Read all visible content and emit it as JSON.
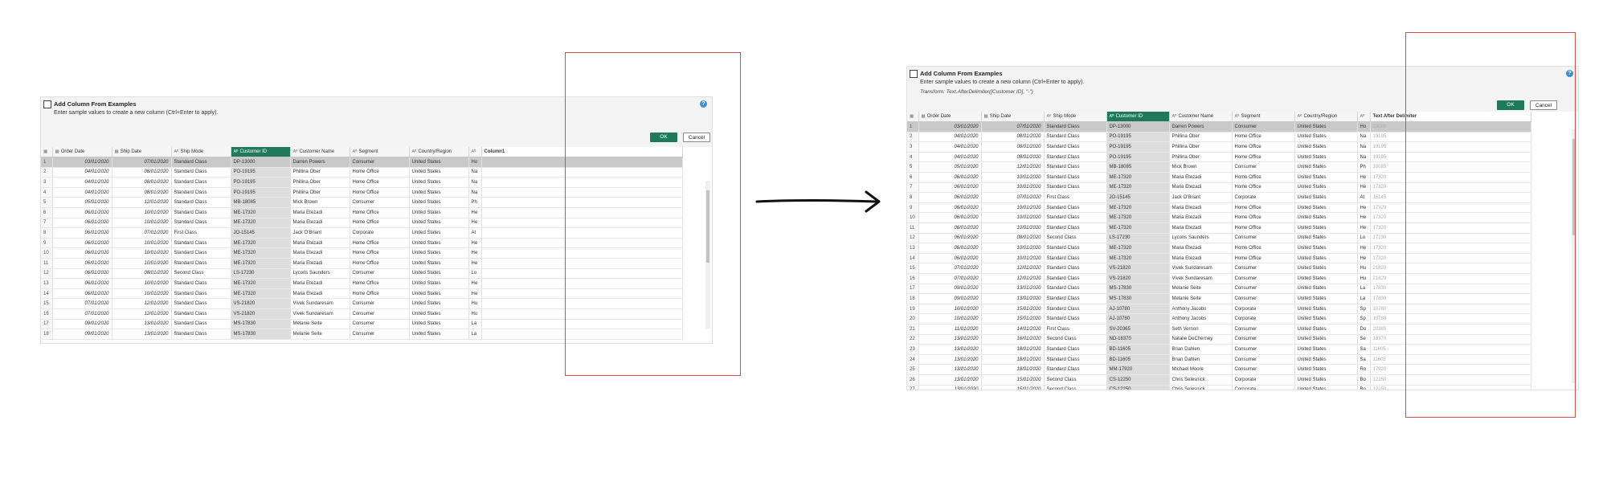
{
  "dialog": {
    "title": "Add Column From Examples",
    "subtitle": "Enter sample values to create a new column (Ctrl+Enter to apply).",
    "ok": "OK",
    "cancel": "Cancel",
    "help": "?",
    "transform": "Transform: Text.AfterDelimiter([Customer ID], \"-\")"
  },
  "icons": {
    "help": "question-circle-icon",
    "arrow": "right-arrow-icon",
    "table": "table-icon",
    "calendar": "calendar-icon",
    "text": "abc-text-icon",
    "checkbox": "checkbox-icon"
  },
  "colors": {
    "accent": "#1f7a5c",
    "highlight": "#e04848"
  },
  "before": {
    "columns": [
      "Order Date",
      "Ship Date",
      "Ship Mode",
      "Customer ID",
      "Customer Name",
      "Segment",
      "Country/Region",
      "",
      "Column1"
    ],
    "rows": [
      [
        "1",
        "03/01/2020",
        "07/01/2020",
        "Standard Class",
        "DP-13000",
        "Darren Powers",
        "Consumer",
        "United States",
        "Ho",
        ""
      ],
      [
        "2",
        "04/01/2020",
        "08/01/2020",
        "Standard Class",
        "PO-19195",
        "Phillina Ober",
        "Home Office",
        "United States",
        "Na",
        ""
      ],
      [
        "3",
        "04/01/2020",
        "08/01/2020",
        "Standard Class",
        "PO-19195",
        "Phillina Ober",
        "Home Office",
        "United States",
        "Na",
        ""
      ],
      [
        "4",
        "04/01/2020",
        "08/01/2020",
        "Standard Class",
        "PO-19195",
        "Phillina Ober",
        "Home Office",
        "United States",
        "Na",
        ""
      ],
      [
        "5",
        "05/01/2020",
        "12/01/2020",
        "Standard Class",
        "MB-18085",
        "Mick Brown",
        "Consumer",
        "United States",
        "Ph",
        ""
      ],
      [
        "6",
        "06/01/2020",
        "10/01/2020",
        "Standard Class",
        "ME-17320",
        "Maria Etezadi",
        "Home Office",
        "United States",
        "He",
        ""
      ],
      [
        "7",
        "06/01/2020",
        "10/01/2020",
        "Standard Class",
        "ME-17320",
        "Maria Etezadi",
        "Home Office",
        "United States",
        "He",
        ""
      ],
      [
        "8",
        "06/01/2020",
        "07/01/2020",
        "First Class",
        "JO-15145",
        "Jack O'Briant",
        "Corporate",
        "United States",
        "At",
        ""
      ],
      [
        "9",
        "06/01/2020",
        "10/01/2020",
        "Standard Class",
        "ME-17320",
        "Maria Etezadi",
        "Home Office",
        "United States",
        "He",
        ""
      ],
      [
        "10",
        "06/01/2020",
        "10/01/2020",
        "Standard Class",
        "ME-17320",
        "Maria Etezadi",
        "Home Office",
        "United States",
        "He",
        ""
      ],
      [
        "11",
        "06/01/2020",
        "10/01/2020",
        "Standard Class",
        "ME-17320",
        "Maria Etezadi",
        "Home Office",
        "United States",
        "He",
        ""
      ],
      [
        "12",
        "06/01/2020",
        "08/01/2020",
        "Second Class",
        "LS-17230",
        "Lycoris Saunders",
        "Consumer",
        "United States",
        "Lo",
        ""
      ],
      [
        "13",
        "06/01/2020",
        "10/01/2020",
        "Standard Class",
        "ME-17320",
        "Maria Etezadi",
        "Home Office",
        "United States",
        "He",
        ""
      ],
      [
        "14",
        "06/01/2020",
        "10/01/2020",
        "Standard Class",
        "ME-17320",
        "Maria Etezadi",
        "Home Office",
        "United States",
        "He",
        ""
      ],
      [
        "15",
        "07/01/2020",
        "12/01/2020",
        "Standard Class",
        "VS-21820",
        "Vivek Sundaresam",
        "Consumer",
        "United States",
        "Hu",
        ""
      ],
      [
        "16",
        "07/01/2020",
        "12/01/2020",
        "Standard Class",
        "VS-21820",
        "Vivek Sundaresam",
        "Consumer",
        "United States",
        "Hu",
        ""
      ],
      [
        "17",
        "09/01/2020",
        "13/01/2020",
        "Standard Class",
        "MS-17830",
        "Melanie Seite",
        "Consumer",
        "United States",
        "La",
        ""
      ],
      [
        "18",
        "09/01/2020",
        "13/01/2020",
        "Standard Class",
        "MS-17830",
        "Melanie Seite",
        "Consumer",
        "United States",
        "La",
        ""
      ]
    ]
  },
  "after": {
    "columns": [
      "Order Date",
      "Ship Date",
      "Ship Mode",
      "Customer ID",
      "Customer Name",
      "Segment",
      "Country/Region",
      "",
      "Text After Delimiter"
    ],
    "rows": [
      [
        "1",
        "03/01/2020",
        "07/01/2020",
        "Standard Class",
        "DP-13000",
        "Darren Powers",
        "Consumer",
        "United States",
        "Ho",
        "13000"
      ],
      [
        "2",
        "04/01/2020",
        "08/01/2020",
        "Standard Class",
        "PO-19195",
        "Phillina Ober",
        "Home Office",
        "United States",
        "Na",
        "19195"
      ],
      [
        "3",
        "04/01/2020",
        "08/01/2020",
        "Standard Class",
        "PO-19195",
        "Phillina Ober",
        "Home Office",
        "United States",
        "Na",
        "19195"
      ],
      [
        "4",
        "04/01/2020",
        "08/01/2020",
        "Standard Class",
        "PO-19195",
        "Phillina Ober",
        "Home Office",
        "United States",
        "Na",
        "19195"
      ],
      [
        "5",
        "05/01/2020",
        "12/01/2020",
        "Standard Class",
        "MB-18085",
        "Mick Brown",
        "Consumer",
        "United States",
        "Ph",
        "18085"
      ],
      [
        "6",
        "06/01/2020",
        "10/01/2020",
        "Standard Class",
        "ME-17320",
        "Maria Etezadi",
        "Home Office",
        "United States",
        "He",
        "17320"
      ],
      [
        "7",
        "06/01/2020",
        "10/01/2020",
        "Standard Class",
        "ME-17320",
        "Maria Etezadi",
        "Home Office",
        "United States",
        "He",
        "17320"
      ],
      [
        "8",
        "06/01/2020",
        "07/01/2020",
        "First Class",
        "JO-15145",
        "Jack O'Briant",
        "Corporate",
        "United States",
        "At",
        "15145"
      ],
      [
        "9",
        "06/01/2020",
        "10/01/2020",
        "Standard Class",
        "ME-17320",
        "Maria Etezadi",
        "Home Office",
        "United States",
        "He",
        "17320"
      ],
      [
        "10",
        "06/01/2020",
        "10/01/2020",
        "Standard Class",
        "ME-17320",
        "Maria Etezadi",
        "Home Office",
        "United States",
        "He",
        "17320"
      ],
      [
        "11",
        "06/01/2020",
        "10/01/2020",
        "Standard Class",
        "ME-17320",
        "Maria Etezadi",
        "Home Office",
        "United States",
        "He",
        "17320"
      ],
      [
        "12",
        "06/01/2020",
        "08/01/2020",
        "Second Class",
        "LS-17230",
        "Lycoris Saunders",
        "Consumer",
        "United States",
        "Lo",
        "17230"
      ],
      [
        "13",
        "06/01/2020",
        "10/01/2020",
        "Standard Class",
        "ME-17320",
        "Maria Etezadi",
        "Home Office",
        "United States",
        "He",
        "17320"
      ],
      [
        "14",
        "06/01/2020",
        "10/01/2020",
        "Standard Class",
        "ME-17320",
        "Maria Etezadi",
        "Home Office",
        "United States",
        "He",
        "17320"
      ],
      [
        "15",
        "07/01/2020",
        "12/01/2020",
        "Standard Class",
        "VS-21820",
        "Vivek Sundaresam",
        "Consumer",
        "United States",
        "Hu",
        "21820"
      ],
      [
        "16",
        "07/01/2020",
        "12/01/2020",
        "Standard Class",
        "VS-21820",
        "Vivek Sundaresam",
        "Consumer",
        "United States",
        "Hu",
        "21820"
      ],
      [
        "17",
        "09/01/2020",
        "13/01/2020",
        "Standard Class",
        "MS-17830",
        "Melanie Seite",
        "Consumer",
        "United States",
        "La",
        "17830"
      ],
      [
        "18",
        "09/01/2020",
        "13/01/2020",
        "Standard Class",
        "MS-17830",
        "Melanie Seite",
        "Consumer",
        "United States",
        "La",
        "17830"
      ],
      [
        "19",
        "10/01/2020",
        "15/01/2020",
        "Standard Class",
        "AJ-10780",
        "Anthony Jacobs",
        "Corporate",
        "United States",
        "Sp",
        "10780"
      ],
      [
        "20",
        "10/01/2020",
        "15/01/2020",
        "Standard Class",
        "AJ-10780",
        "Anthony Jacobs",
        "Corporate",
        "United States",
        "Sp",
        "10780"
      ],
      [
        "21",
        "11/01/2020",
        "14/01/2020",
        "First Class",
        "SV-20365",
        "Seth Vernon",
        "Consumer",
        "United States",
        "Do",
        "20365"
      ],
      [
        "22",
        "13/01/2020",
        "16/01/2020",
        "Second Class",
        "ND-18370",
        "Natalie DeCherney",
        "Consumer",
        "United States",
        "Se",
        "18370"
      ],
      [
        "23",
        "13/01/2020",
        "18/01/2020",
        "Standard Class",
        "BD-11605",
        "Brian Dahlen",
        "Consumer",
        "United States",
        "Sa",
        "11605"
      ],
      [
        "24",
        "13/01/2020",
        "18/01/2020",
        "Standard Class",
        "BD-11605",
        "Brian Dahlen",
        "Consumer",
        "United States",
        "Sa",
        "11605"
      ],
      [
        "25",
        "13/01/2020",
        "18/01/2020",
        "Standard Class",
        "MM-17920",
        "Michael Moore",
        "Consumer",
        "United States",
        "Ro",
        "17920"
      ],
      [
        "26",
        "13/01/2020",
        "15/01/2020",
        "Second Class",
        "CS-12250",
        "Chris Selesnick",
        "Corporate",
        "United States",
        "Bo",
        "12250"
      ],
      [
        "27",
        "13/01/2020",
        "15/01/2020",
        "Second Class",
        "CS-12250",
        "Chris Selesnick",
        "Corporate",
        "United States",
        "Bo",
        "12250"
      ]
    ]
  }
}
